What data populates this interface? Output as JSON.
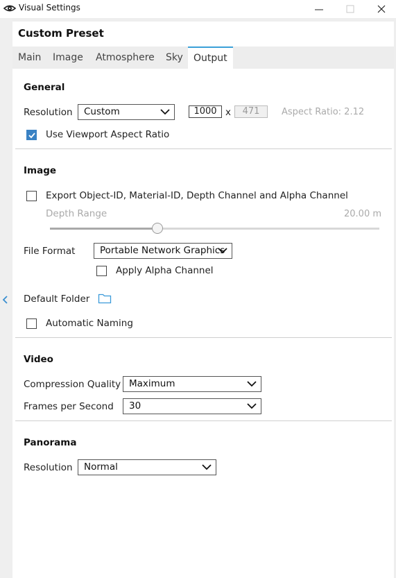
{
  "window": {
    "title": "Visual Settings",
    "minimize_label": "—",
    "maximize_label": "☐",
    "close_label": "✕"
  },
  "preset": {
    "title": "Custom Preset"
  },
  "tabs": [
    "Main",
    "Image",
    "Atmosphere",
    "Sky",
    "Output"
  ],
  "active_tab": "Output",
  "general": {
    "heading": "General",
    "resolution_label": "Resolution",
    "resolution_value": "Custom",
    "width_value": "1000",
    "times_symbol": "x",
    "height_value": "471",
    "aspect_ratio_text": "Aspect Ratio: 2.12",
    "use_viewport_label": "Use Viewport Aspect Ratio",
    "use_viewport_checked": true
  },
  "image": {
    "heading": "Image",
    "export_label": "Export Object-ID, Material-ID, Depth Channel and Alpha Channel",
    "export_checked": false,
    "depth_range_label": "Depth Range",
    "depth_range_value": "20.00 m",
    "depth_range_fraction": 0.33,
    "file_format_label": "File Format",
    "file_format_value": "Portable Network Graphics",
    "apply_alpha_label": "Apply Alpha Channel",
    "apply_alpha_checked": false,
    "default_folder_label": "Default Folder",
    "automatic_naming_label": "Automatic Naming",
    "automatic_naming_checked": false
  },
  "video": {
    "heading": "Video",
    "compression_label": "Compression Quality",
    "compression_value": "Maximum",
    "fps_label": "Frames per Second",
    "fps_value": "30"
  },
  "panorama": {
    "heading": "Panorama",
    "resolution_label": "Resolution",
    "resolution_value": "Normal"
  },
  "colors": {
    "accent": "#3aa0d8",
    "checkbox_checked": "#3a82c4",
    "folder_icon": "#3a9ad9"
  }
}
